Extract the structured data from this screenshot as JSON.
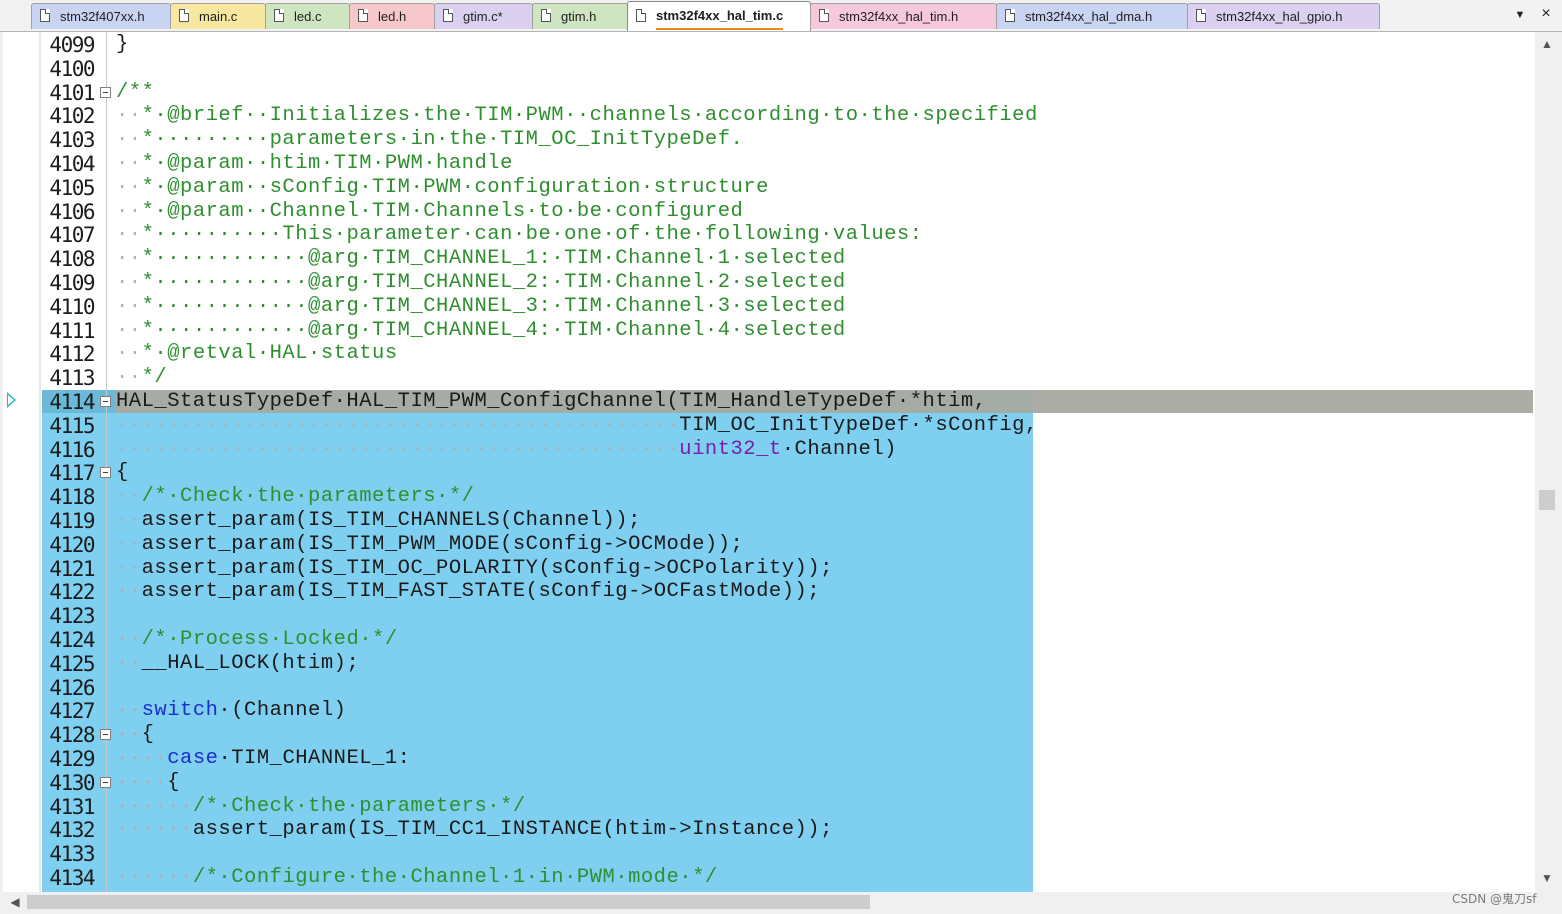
{
  "tabs": [
    {
      "label": "stm32f407xx.h",
      "color": "#c9d3f2",
      "active": false
    },
    {
      "label": "main.c",
      "color": "#f7e7a0",
      "active": false
    },
    {
      "label": "led.c",
      "color": "#cfe4c0",
      "active": false
    },
    {
      "label": "led.h",
      "color": "#f6c8cc",
      "active": false
    },
    {
      "label": "gtim.c*",
      "color": "#dcd0f0",
      "active": false
    },
    {
      "label": "gtim.h",
      "color": "#cfe4c0",
      "active": false
    },
    {
      "label": "stm32f4xx_hal_tim.c",
      "color": "#ffffff",
      "active": true
    },
    {
      "label": "stm32f4xx_hal_tim.h",
      "color": "#f6c8dc",
      "active": false
    },
    {
      "label": "stm32f4xx_hal_dma.h",
      "color": "#c9d3f2",
      "active": false
    },
    {
      "label": "stm32f4xx_hal_gpio.h",
      "color": "#dcd0f0",
      "active": false
    }
  ],
  "tab_dropdown_icon": "chevron-down-icon",
  "tab_close_glyph": "×",
  "colors": {
    "selection": "#7fcff0",
    "caret_line": "#a8aaa0",
    "comment": "#2f8f2f",
    "keyword": "#1a2fd0",
    "type": "#7a1fa8",
    "active_tab_underline": "#e08a1c",
    "current_line_arrow": "#2ab0c8"
  },
  "editor": {
    "selected_lines": "4114-4134",
    "current_line": "4114",
    "lines": [
      {
        "num": "4099",
        "fold": false,
        "segs": [
          {
            "t": "}",
            "k": "n"
          }
        ]
      },
      {
        "num": "4100",
        "fold": false,
        "segs": []
      },
      {
        "num": "4101",
        "fold": true,
        "segs": [
          {
            "t": "/**",
            "k": "c"
          }
        ]
      },
      {
        "num": "4102",
        "fold": false,
        "segs": [
          {
            "t": "··",
            "k": "d"
          },
          {
            "t": "*·@brief··Initializes·the·TIM·PWM··channels·according·to·the·specified",
            "k": "c"
          }
        ]
      },
      {
        "num": "4103",
        "fold": false,
        "segs": [
          {
            "t": "··",
            "k": "d"
          },
          {
            "t": "*·········parameters·in·the·TIM_OC_InitTypeDef.",
            "k": "c"
          }
        ]
      },
      {
        "num": "4104",
        "fold": false,
        "segs": [
          {
            "t": "··",
            "k": "d"
          },
          {
            "t": "*·@param··htim·TIM·PWM·handle",
            "k": "c"
          }
        ]
      },
      {
        "num": "4105",
        "fold": false,
        "segs": [
          {
            "t": "··",
            "k": "d"
          },
          {
            "t": "*·@param··sConfig·TIM·PWM·configuration·structure",
            "k": "c"
          }
        ]
      },
      {
        "num": "4106",
        "fold": false,
        "segs": [
          {
            "t": "··",
            "k": "d"
          },
          {
            "t": "*·@param··Channel·TIM·Channels·to·be·configured",
            "k": "c"
          }
        ]
      },
      {
        "num": "4107",
        "fold": false,
        "segs": [
          {
            "t": "··",
            "k": "d"
          },
          {
            "t": "*··········This·parameter·can·be·one·of·the·following·values:",
            "k": "c"
          }
        ]
      },
      {
        "num": "4108",
        "fold": false,
        "segs": [
          {
            "t": "··",
            "k": "d"
          },
          {
            "t": "*············@arg·TIM_CHANNEL_1:·TIM·Channel·1·selected",
            "k": "c"
          }
        ]
      },
      {
        "num": "4109",
        "fold": false,
        "segs": [
          {
            "t": "··",
            "k": "d"
          },
          {
            "t": "*············@arg·TIM_CHANNEL_2:·TIM·Channel·2·selected",
            "k": "c"
          }
        ]
      },
      {
        "num": "4110",
        "fold": false,
        "segs": [
          {
            "t": "··",
            "k": "d"
          },
          {
            "t": "*············@arg·TIM_CHANNEL_3:·TIM·Channel·3·selected",
            "k": "c"
          }
        ]
      },
      {
        "num": "4111",
        "fold": false,
        "segs": [
          {
            "t": "··",
            "k": "d"
          },
          {
            "t": "*············@arg·TIM_CHANNEL_4:·TIM·Channel·4·selected",
            "k": "c"
          }
        ]
      },
      {
        "num": "4112",
        "fold": false,
        "segs": [
          {
            "t": "··",
            "k": "d"
          },
          {
            "t": "*·@retval·HAL·status",
            "k": "c"
          }
        ]
      },
      {
        "num": "4113",
        "fold": false,
        "segs": [
          {
            "t": "··",
            "k": "d"
          },
          {
            "t": "*/",
            "k": "c"
          }
        ]
      },
      {
        "num": "4114",
        "fold": true,
        "segs": [
          {
            "t": "HAL_StatusTypeDef·HAL_TIM_PWM_ConfigChannel(TIM_HandleTypeDef·*htim,",
            "k": "n"
          }
        ]
      },
      {
        "num": "4115",
        "fold": false,
        "segs": [
          {
            "t": "············································",
            "k": "d"
          },
          {
            "t": "TIM_OC_InitTypeDef·*sConfig,",
            "k": "n"
          }
        ]
      },
      {
        "num": "4116",
        "fold": false,
        "segs": [
          {
            "t": "············································",
            "k": "d"
          },
          {
            "t": "uint32_t",
            "k": "ty"
          },
          {
            "t": "·Channel)",
            "k": "n"
          }
        ]
      },
      {
        "num": "4117",
        "fold": true,
        "segs": [
          {
            "t": "{",
            "k": "n"
          }
        ]
      },
      {
        "num": "4118",
        "fold": false,
        "segs": [
          {
            "t": "··",
            "k": "d"
          },
          {
            "t": "/*·Check·the·parameters·*/",
            "k": "c"
          }
        ]
      },
      {
        "num": "4119",
        "fold": false,
        "segs": [
          {
            "t": "··",
            "k": "d"
          },
          {
            "t": "assert_param(IS_TIM_CHANNELS(Channel));",
            "k": "n"
          }
        ]
      },
      {
        "num": "4120",
        "fold": false,
        "segs": [
          {
            "t": "··",
            "k": "d"
          },
          {
            "t": "assert_param(IS_TIM_PWM_MODE(sConfig->OCMode));",
            "k": "n"
          }
        ]
      },
      {
        "num": "4121",
        "fold": false,
        "segs": [
          {
            "t": "··",
            "k": "d"
          },
          {
            "t": "assert_param(IS_TIM_OC_POLARITY(sConfig->OCPolarity));",
            "k": "n"
          }
        ]
      },
      {
        "num": "4122",
        "fold": false,
        "segs": [
          {
            "t": "··",
            "k": "d"
          },
          {
            "t": "assert_param(IS_TIM_FAST_STATE(sConfig->OCFastMode));",
            "k": "n"
          }
        ]
      },
      {
        "num": "4123",
        "fold": false,
        "segs": []
      },
      {
        "num": "4124",
        "fold": false,
        "segs": [
          {
            "t": "··",
            "k": "d"
          },
          {
            "t": "/*·Process·Locked·*/",
            "k": "c"
          }
        ]
      },
      {
        "num": "4125",
        "fold": false,
        "segs": [
          {
            "t": "··",
            "k": "d"
          },
          {
            "t": "__HAL_LOCK(htim);",
            "k": "n"
          }
        ]
      },
      {
        "num": "4126",
        "fold": false,
        "segs": []
      },
      {
        "num": "4127",
        "fold": false,
        "segs": [
          {
            "t": "··",
            "k": "d"
          },
          {
            "t": "switch",
            "k": "kw"
          },
          {
            "t": "·(Channel)",
            "k": "n"
          }
        ]
      },
      {
        "num": "4128",
        "fold": true,
        "segs": [
          {
            "t": "··",
            "k": "d"
          },
          {
            "t": "{",
            "k": "n"
          }
        ]
      },
      {
        "num": "4129",
        "fold": false,
        "segs": [
          {
            "t": "····",
            "k": "d"
          },
          {
            "t": "case",
            "k": "kw"
          },
          {
            "t": "·TIM_CHANNEL_1:",
            "k": "n"
          }
        ]
      },
      {
        "num": "4130",
        "fold": true,
        "segs": [
          {
            "t": "····",
            "k": "d"
          },
          {
            "t": "{",
            "k": "n"
          }
        ]
      },
      {
        "num": "4131",
        "fold": false,
        "segs": [
          {
            "t": "······",
            "k": "d"
          },
          {
            "t": "/*·Check·the·parameters·*/",
            "k": "c"
          }
        ]
      },
      {
        "num": "4132",
        "fold": false,
        "segs": [
          {
            "t": "······",
            "k": "d"
          },
          {
            "t": "assert_param(IS_TIM_CC1_INSTANCE(htim->Instance));",
            "k": "n"
          }
        ]
      },
      {
        "num": "4133",
        "fold": false,
        "segs": []
      },
      {
        "num": "4134",
        "fold": false,
        "segs": [
          {
            "t": "······",
            "k": "d"
          },
          {
            "t": "/*·Configure·the·Channel·1·in·PWM·mode·*/",
            "k": "c"
          }
        ]
      }
    ]
  },
  "vscroll_position": 0.55,
  "watermark": "CSDN @鬼刀sf"
}
